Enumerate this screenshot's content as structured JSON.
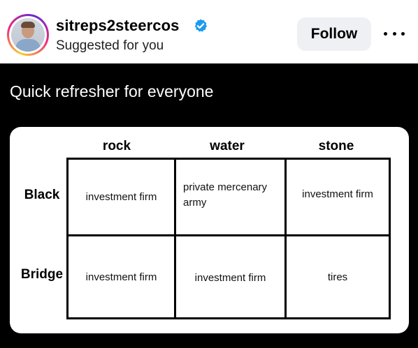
{
  "header": {
    "username": "sitreps2steercos",
    "subtitle": "Suggested for you",
    "follow_label": "Follow"
  },
  "post": {
    "caption": "Quick refresher for everyone",
    "table": {
      "columns": [
        "rock",
        "water",
        "stone"
      ],
      "rows": [
        {
          "label": "Black",
          "cells": [
            "investment firm",
            "private mercenary army",
            "investment firm"
          ]
        },
        {
          "label": "Bridge",
          "cells": [
            "investment firm",
            "investment firm",
            "tires"
          ]
        }
      ]
    }
  },
  "icons": [
    "verified-badge-icon",
    "more-options-icon"
  ],
  "colors": {
    "verified": "#1d9bf0",
    "follow_bg": "#eff0f3",
    "post_bg": "#000000"
  }
}
